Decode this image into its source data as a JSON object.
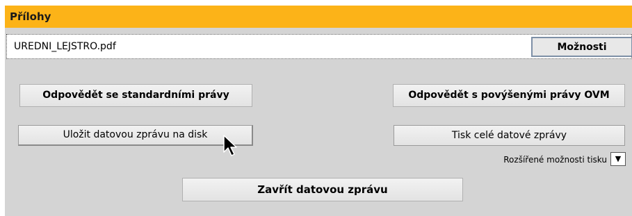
{
  "attachments": {
    "title": "Přílohy",
    "file_name": "UREDNI_LEJSTRO.pdf",
    "options_label": "Možnosti"
  },
  "actions": {
    "reply_standard_label": "Odpovědět se standardními právy",
    "reply_ovm_label": "Odpovědět s povýšenými právy OVM",
    "save_to_disk_label": "Uložit datovou zprávu na disk",
    "print_label": "Tisk celé datové zprávy",
    "extended_print_label": "Rozšířené možnosti tisku",
    "extended_print_toggle": "▼",
    "close_label": "Zavřít datovou zprávu"
  },
  "icons": {
    "cursor": "arrow-cursor-icon",
    "dropdown": "triangle-down-icon"
  },
  "colors": {
    "header": "#fcb318",
    "panel": "#d4d4d4"
  }
}
